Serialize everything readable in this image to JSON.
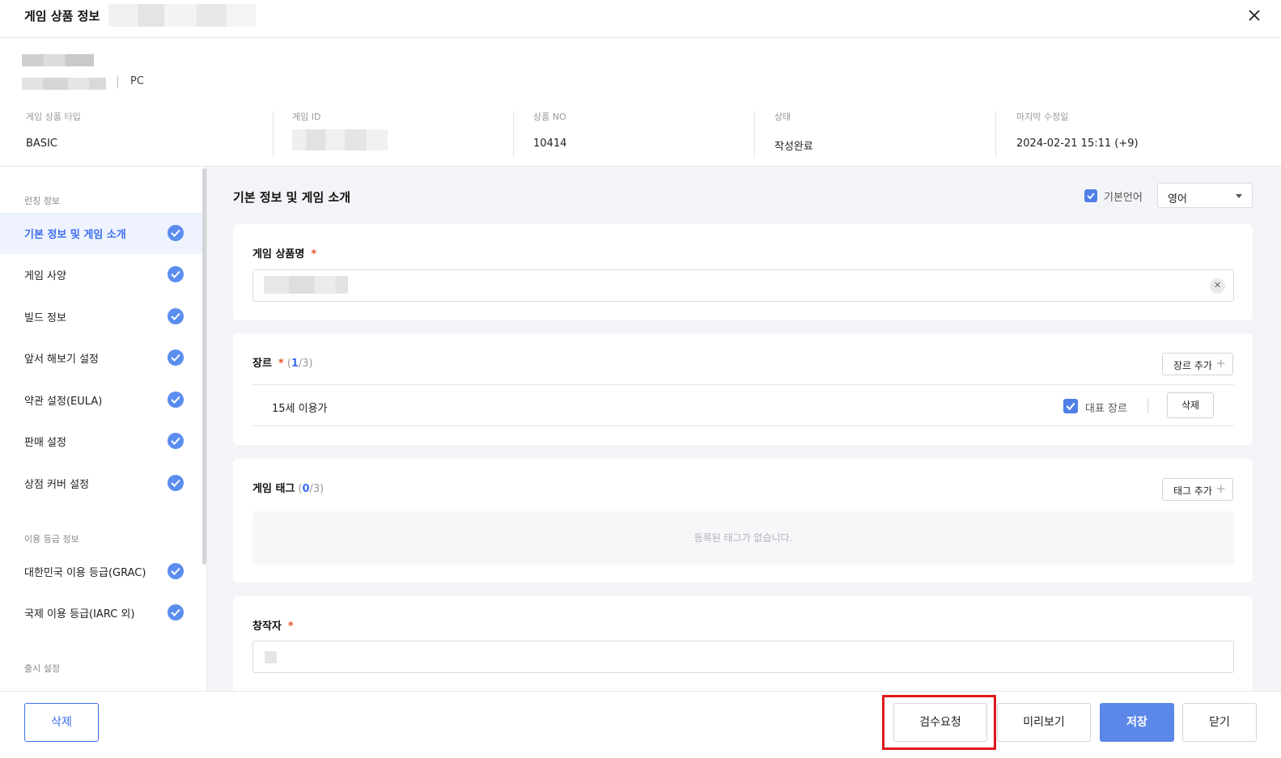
{
  "header": {
    "title": "게임 상품 정보",
    "close_icon": "close-icon"
  },
  "info": {
    "platform": "PC",
    "meta": [
      {
        "label": "게임 상품 타입",
        "value": "BASIC"
      },
      {
        "label": "게임 ID",
        "value": ""
      },
      {
        "label": "상품 NO",
        "value": "10414"
      },
      {
        "label": "상태",
        "value": "작성완료"
      },
      {
        "label": "마지막 수정일",
        "value": "2024-02-21 15:11 (+9)"
      }
    ]
  },
  "sidebar": {
    "sections": {
      "listing": "런칭 정보",
      "rating": "이용 등급 정보",
      "release": "출시 설정"
    },
    "items": [
      {
        "label": "기본 정보 및 게임 소개",
        "active": true
      },
      {
        "label": "게임 사양"
      },
      {
        "label": "빌드 정보"
      },
      {
        "label": "앞서 해보기 설정"
      },
      {
        "label": "약관 설정(EULA)"
      },
      {
        "label": "판매 설정"
      },
      {
        "label": "상점 커버 설정"
      },
      {
        "label": "대한민국 이용 등급(GRAC)"
      },
      {
        "label": "국제 이용 등급(IARC 외)"
      }
    ]
  },
  "main": {
    "title": "기본 정보 및 게임 소개",
    "default_language_label": "기본언어",
    "language_value": "영어",
    "product_name": {
      "label": "게임 상품명",
      "required": "*"
    },
    "genre": {
      "label": "장르",
      "required": "*",
      "count_open": "(",
      "count_current": "1",
      "count_total": "/3)",
      "add_button": "장르 추가",
      "rows": [
        {
          "name": "15세 이용가",
          "representative_label": "대표 장르",
          "delete_button": "삭제"
        }
      ]
    },
    "tags": {
      "label": "게임 태그",
      "count_open": "(",
      "count_current": "0",
      "count_total": "/3)",
      "add_button": "태그 추가",
      "empty_message": "등록된 태그가 없습니다."
    },
    "creator": {
      "label": "창작자",
      "required": "*"
    }
  },
  "footer": {
    "delete": "삭제",
    "review_request": "검수요청",
    "preview": "미리보기",
    "save": "저장",
    "close": "닫기"
  },
  "colors": {
    "accent": "#3d6ef0",
    "check": "#5b8def",
    "save_button": "#5b87e8",
    "highlight": "#e01818"
  }
}
